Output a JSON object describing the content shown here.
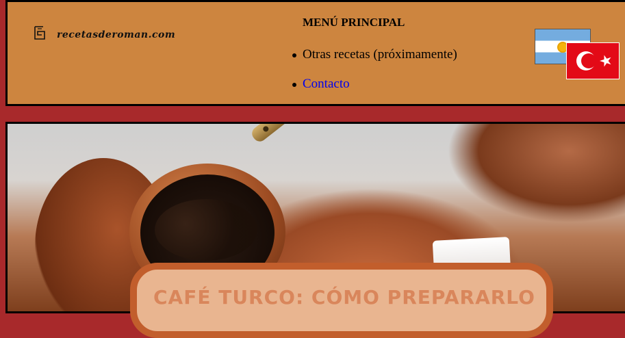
{
  "header": {
    "logo_text": "recetasderoman.com",
    "logo_icon": "book-icon",
    "menu": {
      "title": "MENÚ PRINCIPAL",
      "items": [
        {
          "label": "Otras recetas (próximamente)",
          "link": false
        },
        {
          "label": "Contacto",
          "link": true
        }
      ]
    },
    "flags": [
      "argentina-flag-icon",
      "turkey-flag-icon"
    ]
  },
  "hero": {
    "title": "CAFÉ TURCO: CÓMO PREPARARLO"
  },
  "colors": {
    "page_background": "#a8292b",
    "header_background": "#cd853f",
    "link": "#0000ee",
    "title_box_fill": "#e9b590",
    "title_box_border": "#c25e2c",
    "title_text": "#d9865b"
  }
}
